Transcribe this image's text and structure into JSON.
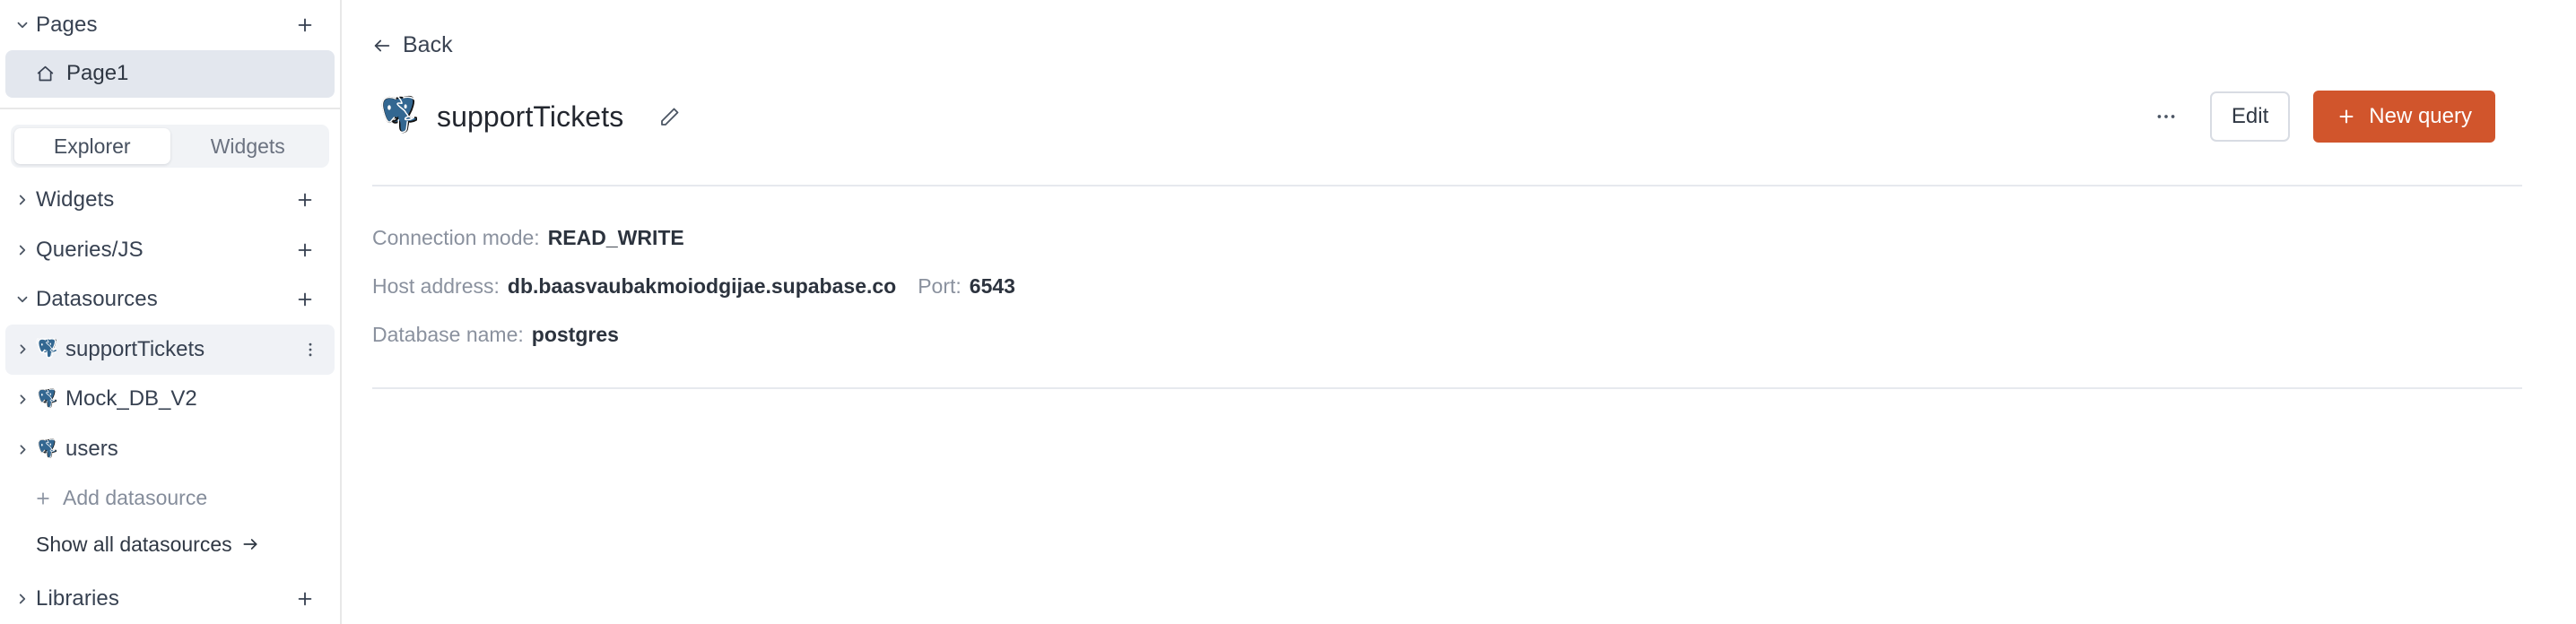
{
  "sidebar": {
    "pages_section": {
      "label": "Pages",
      "expanded": true,
      "add_icon": "plus-icon",
      "caret_icon": "chevron-down-icon"
    },
    "pages": [
      {
        "label": "Page1",
        "icon": "home-icon",
        "selected": true
      }
    ],
    "tabs": [
      {
        "label": "Explorer",
        "active": true
      },
      {
        "label": "Widgets",
        "active": false
      }
    ],
    "tree": [
      {
        "label": "Widgets",
        "caret_icon": "chevron-right-icon",
        "add_icon": "plus-icon"
      },
      {
        "label": "Queries/JS",
        "caret_icon": "chevron-right-icon",
        "add_icon": "plus-icon"
      },
      {
        "label": "Datasources",
        "caret_icon": "chevron-down-icon",
        "add_icon": "plus-icon"
      }
    ],
    "datasources": [
      {
        "label": "supportTickets",
        "icon": "postgres-icon",
        "selected": true,
        "menu_icon": "more-vertical-icon"
      },
      {
        "label": "Mock_DB_V2",
        "icon": "postgres-icon",
        "selected": false
      },
      {
        "label": "users",
        "icon": "postgres-icon",
        "selected": false
      }
    ],
    "add_datasource": {
      "label": "Add datasource",
      "icon": "plus-icon"
    },
    "show_all_datasources": {
      "label": "Show all datasources",
      "icon": "arrow-right-icon"
    },
    "libraries_section": {
      "label": "Libraries",
      "caret_icon": "chevron-right-icon",
      "add_icon": "plus-icon"
    }
  },
  "main": {
    "back": {
      "label": "Back",
      "icon": "arrow-left-icon"
    },
    "title": "supportTickets",
    "title_icon": "postgres-icon",
    "edit_name_icon": "pencil-icon",
    "more_icon": "more-horizontal-icon",
    "edit_button": "Edit",
    "new_query_button": "New query",
    "new_query_icon": "plus-icon",
    "details": [
      {
        "key": "Connection mode:",
        "value": "READ_WRITE"
      },
      {
        "key": "Host address:",
        "value": "db.baasvaubakmoiodgijae.supabase.co",
        "key2": "Port:",
        "value2": "6543"
      },
      {
        "key": "Database name:",
        "value": "postgres"
      }
    ]
  },
  "colors": {
    "accent": "#d1552c",
    "selected_row": "#e3e7ee",
    "selected_ds_row": "#f0f2f6",
    "border": "#e8e8e8",
    "text_primary": "#2c333e",
    "text_muted": "#8a919e"
  }
}
